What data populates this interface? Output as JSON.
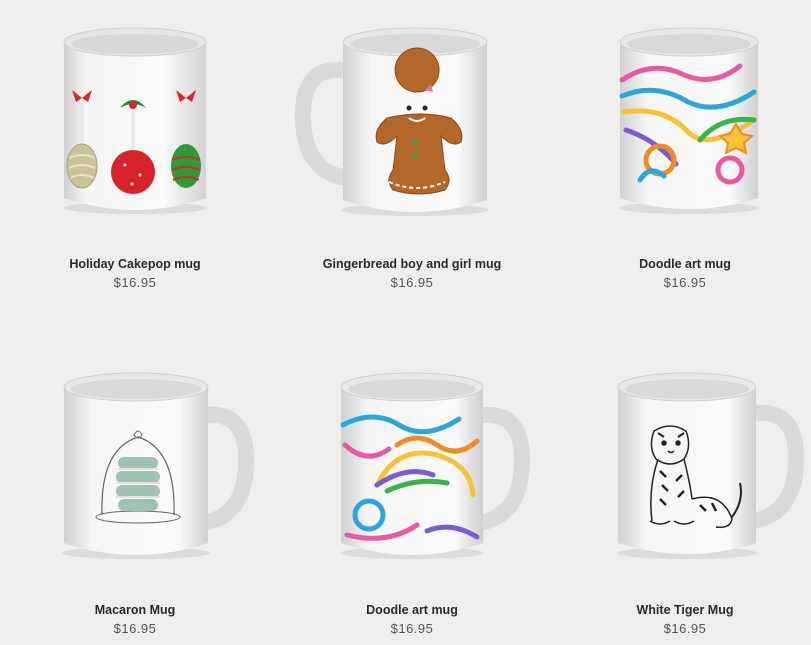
{
  "products": [
    {
      "title": "Holiday Cakepop mug",
      "price": "$16.95",
      "design": "cakepop-illustration"
    },
    {
      "title": "Gingerbread boy and girl mug",
      "price": "$16.95",
      "design": "gingerbread-illustration"
    },
    {
      "title": "Doodle art mug",
      "price": "$16.95",
      "design": "doodle-swirl-illustration"
    },
    {
      "title": "Macaron Mug",
      "price": "$16.95",
      "design": "macaron-cloche-illustration"
    },
    {
      "title": "Doodle art mug",
      "price": "$16.95",
      "design": "doodle-swirl-illustration"
    },
    {
      "title": "White Tiger Mug",
      "price": "$16.95",
      "design": "tiger-illustration"
    }
  ]
}
